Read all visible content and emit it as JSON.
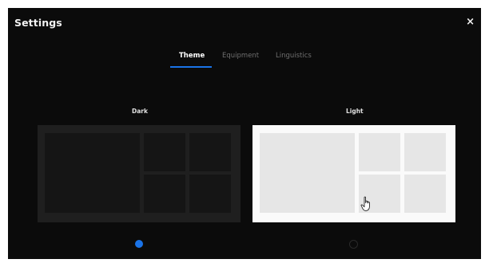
{
  "dialog": {
    "title": "Settings",
    "close_glyph": "×",
    "close_icon": "close-icon"
  },
  "tabs": [
    {
      "label": "Theme",
      "active": true
    },
    {
      "label": "Equipment",
      "active": false
    },
    {
      "label": "Linguistics",
      "active": false
    }
  ],
  "themes": {
    "dark": {
      "label": "Dark",
      "selected": true
    },
    "light": {
      "label": "Light",
      "selected": false
    }
  },
  "colors": {
    "dialog_background": "#0b0b0b",
    "accent": "#1a73e8",
    "dark_preview": "#1f1f1f",
    "light_preview": "#fafafa"
  },
  "icons": {
    "cursor": "hand-pointer-icon"
  }
}
